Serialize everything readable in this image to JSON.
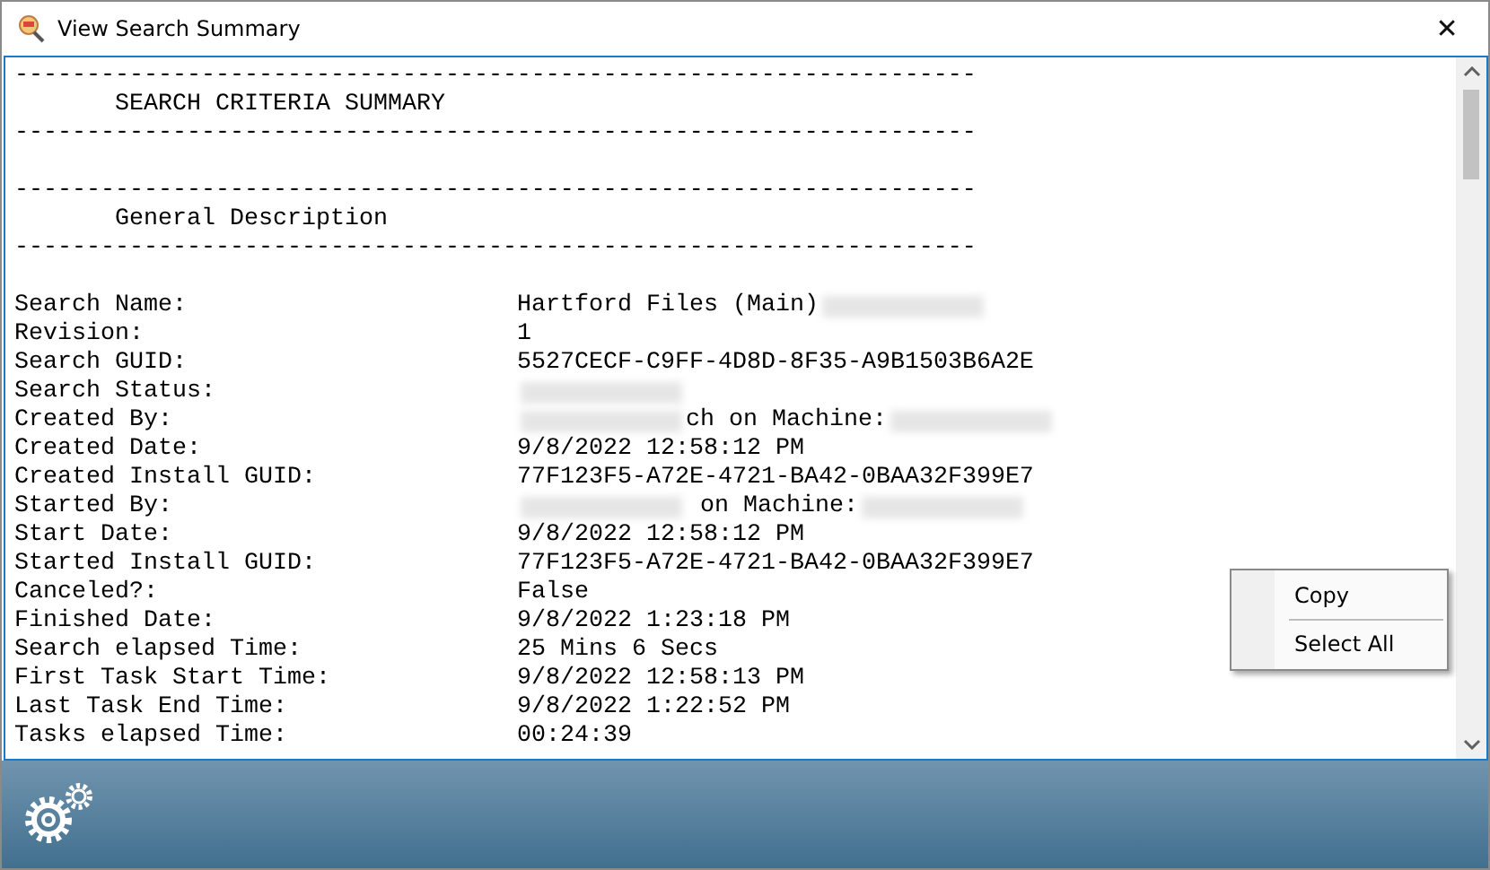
{
  "window": {
    "title": "View Search Summary",
    "close": "✕"
  },
  "report": {
    "lines": [
      {
        "kind": "rule",
        "text": "-------------------------------------------------------------------"
      },
      {
        "kind": "heading",
        "text": "       SEARCH CRITERIA SUMMARY"
      },
      {
        "kind": "rule",
        "text": "-------------------------------------------------------------------"
      },
      {
        "kind": "blank"
      },
      {
        "kind": "rule",
        "text": "-------------------------------------------------------------------"
      },
      {
        "kind": "heading",
        "text": "       General Description"
      },
      {
        "kind": "rule",
        "text": "-------------------------------------------------------------------"
      },
      {
        "kind": "blank"
      },
      {
        "kind": "field",
        "label": "Search Name:",
        "parts": [
          {
            "kind": "text",
            "text": "Hartford Files (Main)"
          },
          {
            "kind": "redacted"
          }
        ]
      },
      {
        "kind": "field",
        "label": "Revision:",
        "parts": [
          {
            "kind": "text",
            "text": "1"
          }
        ]
      },
      {
        "kind": "field",
        "label": "Search GUID:",
        "parts": [
          {
            "kind": "text",
            "text": "5527CECF-C9FF-4D8D-8F35-A9B1503B6A2E"
          }
        ]
      },
      {
        "kind": "field",
        "label": "Search Status:",
        "parts": [
          {
            "kind": "redacted"
          }
        ]
      },
      {
        "kind": "field",
        "label": "Created By:",
        "parts": [
          {
            "kind": "redacted"
          },
          {
            "kind": "text",
            "text": "ch on Machine:"
          },
          {
            "kind": "redacted"
          }
        ]
      },
      {
        "kind": "field",
        "label": "Created Date:",
        "parts": [
          {
            "kind": "text",
            "text": "9/8/2022 12:58:12 PM"
          }
        ]
      },
      {
        "kind": "field",
        "label": "Created Install GUID:",
        "parts": [
          {
            "kind": "text",
            "text": "77F123F5-A72E-4721-BA42-0BAA32F399E7"
          }
        ]
      },
      {
        "kind": "field",
        "label": "Started By:",
        "parts": [
          {
            "kind": "redacted"
          },
          {
            "kind": "text",
            "text": " on Machine:"
          },
          {
            "kind": "redacted"
          }
        ]
      },
      {
        "kind": "field",
        "label": "Start Date:",
        "parts": [
          {
            "kind": "text",
            "text": "9/8/2022 12:58:12 PM"
          }
        ]
      },
      {
        "kind": "field",
        "label": "Started Install GUID:",
        "parts": [
          {
            "kind": "text",
            "text": "77F123F5-A72E-4721-BA42-0BAA32F399E7"
          }
        ]
      },
      {
        "kind": "field",
        "label": "Canceled?:",
        "parts": [
          {
            "kind": "text",
            "text": "False"
          }
        ]
      },
      {
        "kind": "field",
        "label": "Finished Date:",
        "parts": [
          {
            "kind": "text",
            "text": "9/8/2022 1:23:18 PM"
          }
        ]
      },
      {
        "kind": "field",
        "label": "Search elapsed Time:",
        "parts": [
          {
            "kind": "text",
            "text": "25 Mins 6 Secs"
          }
        ]
      },
      {
        "kind": "field",
        "label": "First Task Start Time:",
        "parts": [
          {
            "kind": "text",
            "text": "9/8/2022 12:58:13 PM"
          }
        ]
      },
      {
        "kind": "field",
        "label": "Last Task End Time:",
        "parts": [
          {
            "kind": "text",
            "text": "9/8/2022 1:22:52 PM"
          }
        ]
      },
      {
        "kind": "field",
        "label": "Tasks elapsed Time:",
        "parts": [
          {
            "kind": "text",
            "text": "00:24:39"
          }
        ]
      }
    ]
  },
  "context_menu": {
    "items": [
      "Copy",
      "Select All"
    ]
  }
}
